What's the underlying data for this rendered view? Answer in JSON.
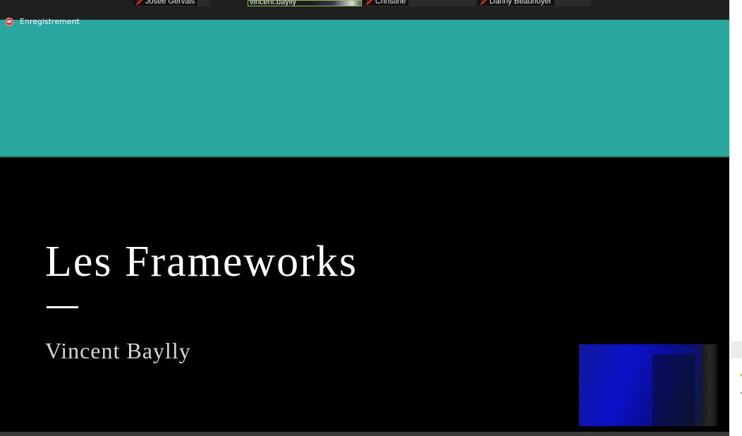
{
  "meeting": {
    "recording_label": "Enregistrement",
    "participants": [
      {
        "name": "Josée Gervais",
        "muted": true
      },
      {
        "name": "vincent.baylly",
        "muted": false,
        "active_speaker": true
      },
      {
        "name": "Christine",
        "muted": true
      },
      {
        "name": "Danny Beauhoyer",
        "muted": true
      }
    ]
  },
  "slide": {
    "title": "Les Frameworks",
    "subtitle": "Vincent Baylly",
    "accent_color": "#2aa8a0",
    "background_color": "#000000"
  },
  "icons": {
    "recording": "record-icon",
    "muted": "mic-muted-icon"
  }
}
